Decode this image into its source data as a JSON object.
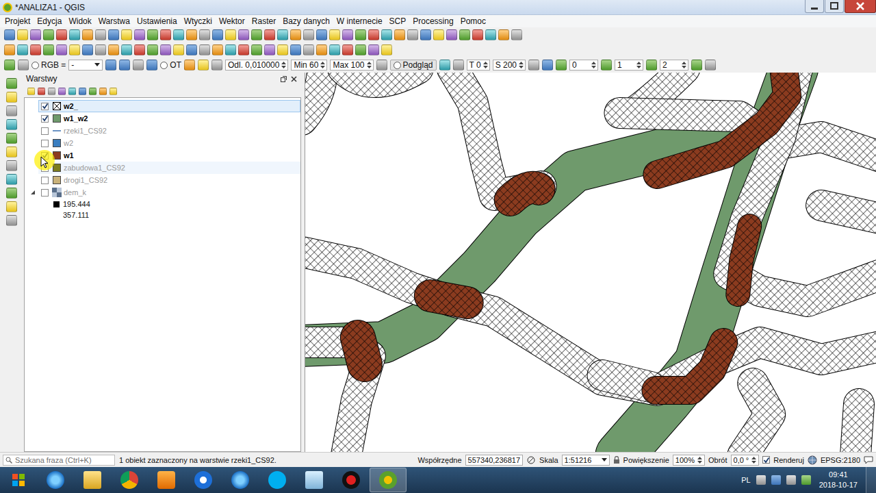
{
  "window": {
    "title": "*ANALIZA1 - QGIS"
  },
  "menu": [
    "Projekt",
    "Edycja",
    "Widok",
    "Warstwa",
    "Ustawienia",
    "Wtyczki",
    "Wektor",
    "Raster",
    "Bazy danych",
    "W internecie",
    "SCP",
    "Processing",
    "Pomoc"
  ],
  "scp_toolbar": {
    "mode": "RGB =",
    "dropdown": "-",
    "ot": "OT",
    "distance": "Odl. 0,010000",
    "min": "Min 60",
    "max": "Max 100",
    "preview": "Podgląd",
    "t": "T 0",
    "s": "S 200",
    "fields": [
      "0",
      "1",
      "2"
    ]
  },
  "layers_panel": {
    "title": "Warstwy",
    "layers": [
      {
        "name": "w2_",
        "checked": true,
        "selected": true,
        "hovered": false,
        "kind": "hatch",
        "color": "#ffffff",
        "expanded": false
      },
      {
        "name": "w1_w2",
        "checked": true,
        "selected": false,
        "hovered": false,
        "kind": "fill",
        "color": "#6f9a6c",
        "expanded": false
      },
      {
        "name": "rzeki1_CS92",
        "checked": false,
        "selected": false,
        "hovered": false,
        "kind": "line",
        "color": "#3a6fb0",
        "expanded": false
      },
      {
        "name": "w2",
        "checked": false,
        "selected": false,
        "hovered": false,
        "kind": "fill",
        "color": "#3a7ec0",
        "expanded": false
      },
      {
        "name": "w1",
        "checked": true,
        "selected": false,
        "hovered": false,
        "kind": "fill",
        "color": "#8b3b1f",
        "expanded": false
      },
      {
        "name": "zabudowa1_CS92",
        "checked": false,
        "selected": false,
        "hovered": true,
        "kind": "fill",
        "color": "#7d7d1e",
        "expanded": false
      },
      {
        "name": "drogi1_CS92",
        "checked": false,
        "selected": false,
        "hovered": false,
        "kind": "fill",
        "color": "#c9b27a",
        "expanded": false
      },
      {
        "name": "dem_k",
        "checked": false,
        "selected": false,
        "hovered": false,
        "kind": "raster",
        "color": "#5a6f8a",
        "expanded": true,
        "legend": [
          {
            "value": "195.444",
            "color": "#000000"
          },
          {
            "value": "357.111",
            "color": "#ffffff"
          }
        ]
      }
    ]
  },
  "status_bar": {
    "search_placeholder": "Szukana fraza (Ctrl+K)",
    "message": "1 obiekt zaznaczony na warstwie rzeki1_CS92.",
    "coord_label": "Współrzędne",
    "coords": "557340,236817",
    "scale_label": "Skala",
    "scale": "1:51216",
    "magnifier_label": "Powiększenie",
    "magnifier": "100%",
    "rotation_label": "Obrót",
    "rotation": "0,0 °",
    "render_label": "Renderuj",
    "render_checked": true,
    "crs": "EPSG:2180"
  },
  "taskbar": {
    "language": "PL",
    "time": "09:41",
    "date": "2018-10-17"
  }
}
